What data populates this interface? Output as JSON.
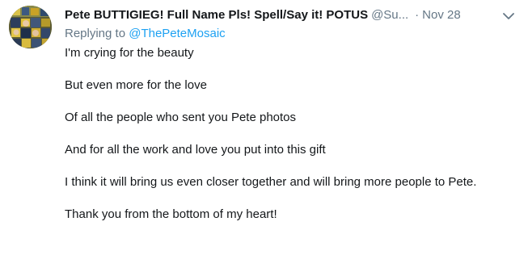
{
  "tweet": {
    "display_name": "Pete BUTTIGIEG! Full Name Pls! Spell/Say it! POTUS",
    "handle": "@Su...",
    "separator": "·",
    "timestamp": "Nov 28",
    "replying_prefix": "Replying to",
    "replying_to": "@ThePeteMosaic",
    "paragraphs": [
      "I'm crying for the beauty",
      "But even more for the love",
      "Of all the people who sent you Pete photos",
      "And for all the work and love you put into this gift",
      "I think it will bring us even closer together and will bring more people to Pete.",
      "Thank you from the bottom of my heart!"
    ]
  },
  "icons": {
    "avatar": "profile-photo-collage",
    "caret": "chevron-down-icon"
  },
  "colors": {
    "text_primary": "#14171a",
    "text_secondary": "#657786",
    "link": "#1da1f2",
    "background": "#ffffff"
  }
}
